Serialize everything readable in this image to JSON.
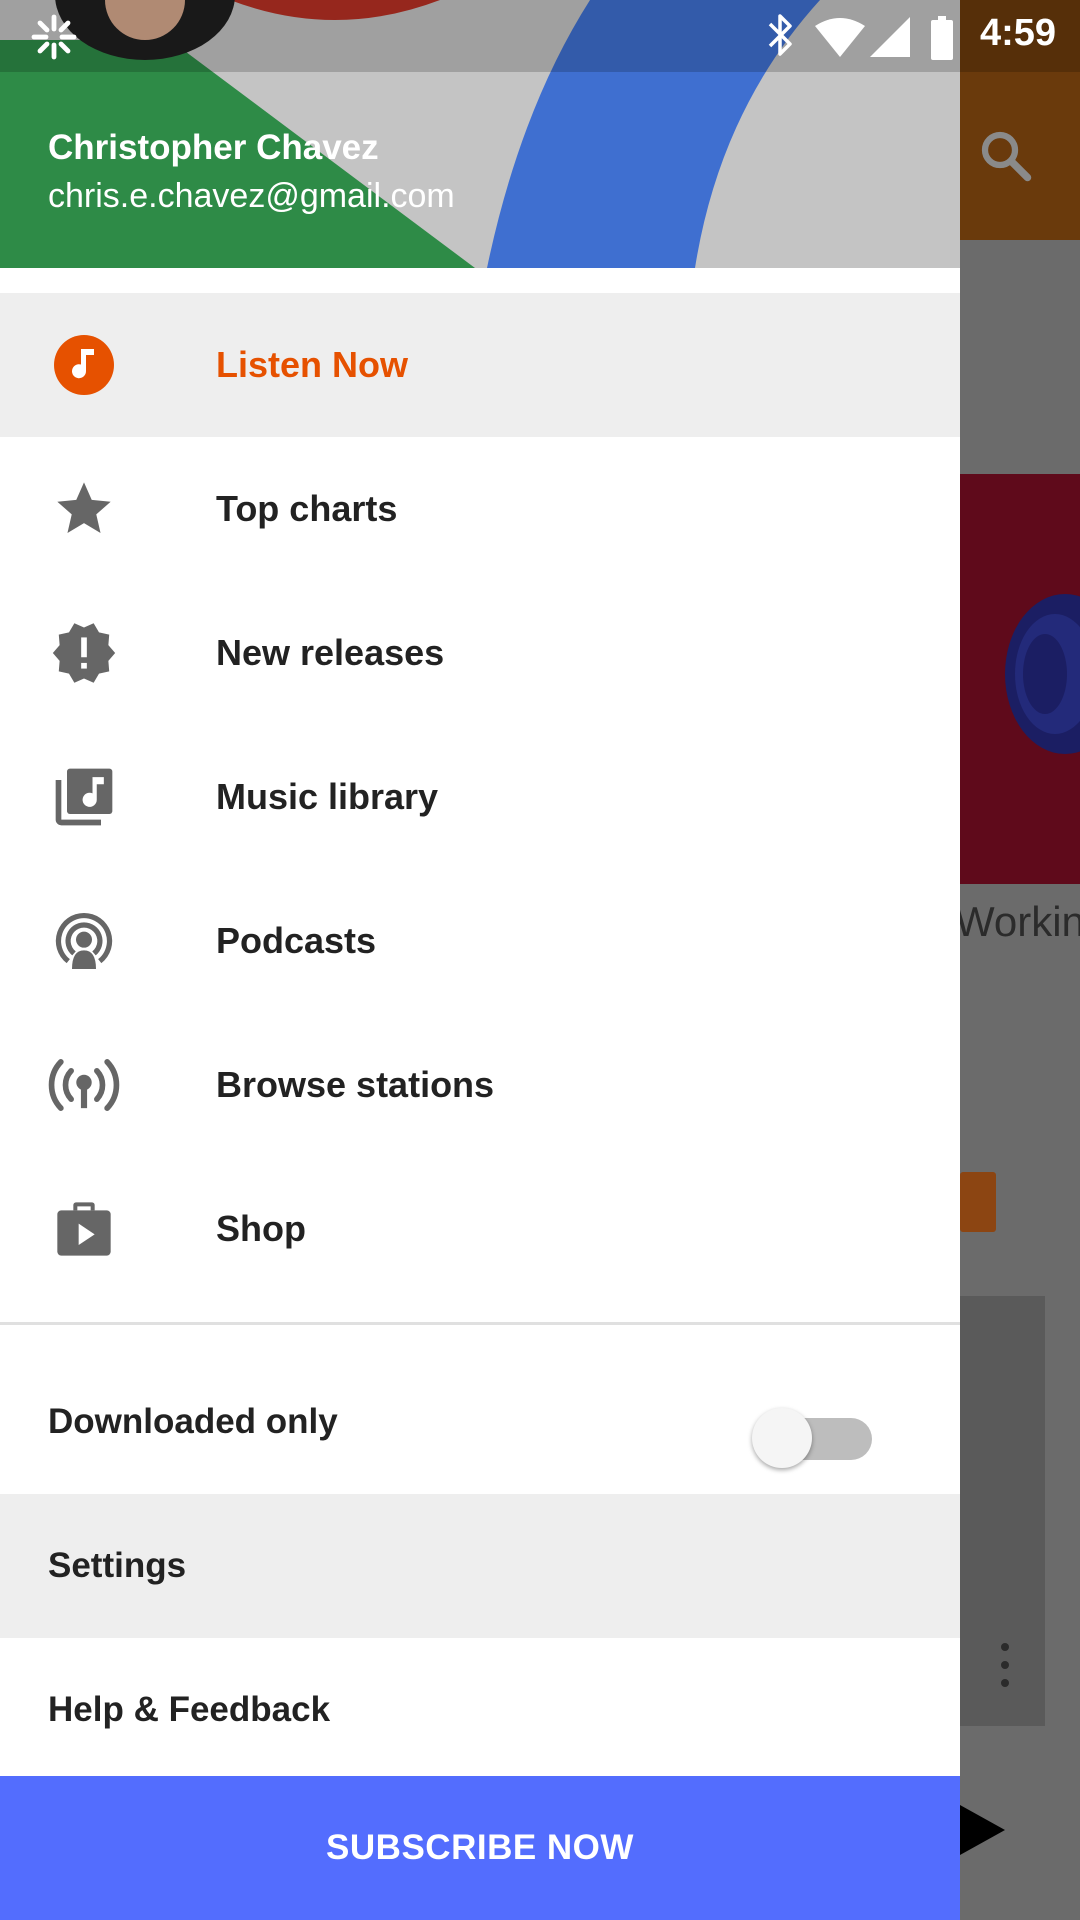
{
  "status_bar": {
    "time": "4:59",
    "battery_level": "100",
    "icons": [
      "app-notification-icon",
      "bluetooth-icon",
      "wifi-icon",
      "cell-signal-icon",
      "battery-icon"
    ]
  },
  "account": {
    "name": "Christopher Chavez",
    "email": "chris.e.chavez@gmail.com"
  },
  "menu": {
    "items": [
      {
        "label": "Listen Now",
        "icon": "listen-now-icon",
        "active": true
      },
      {
        "label": "Top charts",
        "icon": "star-icon",
        "active": false
      },
      {
        "label": "New releases",
        "icon": "new-releases-icon",
        "active": false
      },
      {
        "label": "Music library",
        "icon": "music-library-icon",
        "active": false
      },
      {
        "label": "Podcasts",
        "icon": "podcast-icon",
        "active": false
      },
      {
        "label": "Browse stations",
        "icon": "radio-station-icon",
        "active": false
      },
      {
        "label": "Shop",
        "icon": "shop-icon",
        "active": false
      }
    ]
  },
  "downloaded_only": {
    "label": "Downloaded only",
    "enabled": false
  },
  "settings_label": "Settings",
  "help_label": "Help & Feedback",
  "subscribe_label": "SUBSCRIBE NOW",
  "background": {
    "card_caption": "Workin"
  },
  "colors": {
    "accent": "#e65100",
    "subscribe_button": "#536dfe",
    "active_row": "#eeeeee",
    "header_green": "#2e8b47",
    "header_blue": "#3f6fd0"
  }
}
